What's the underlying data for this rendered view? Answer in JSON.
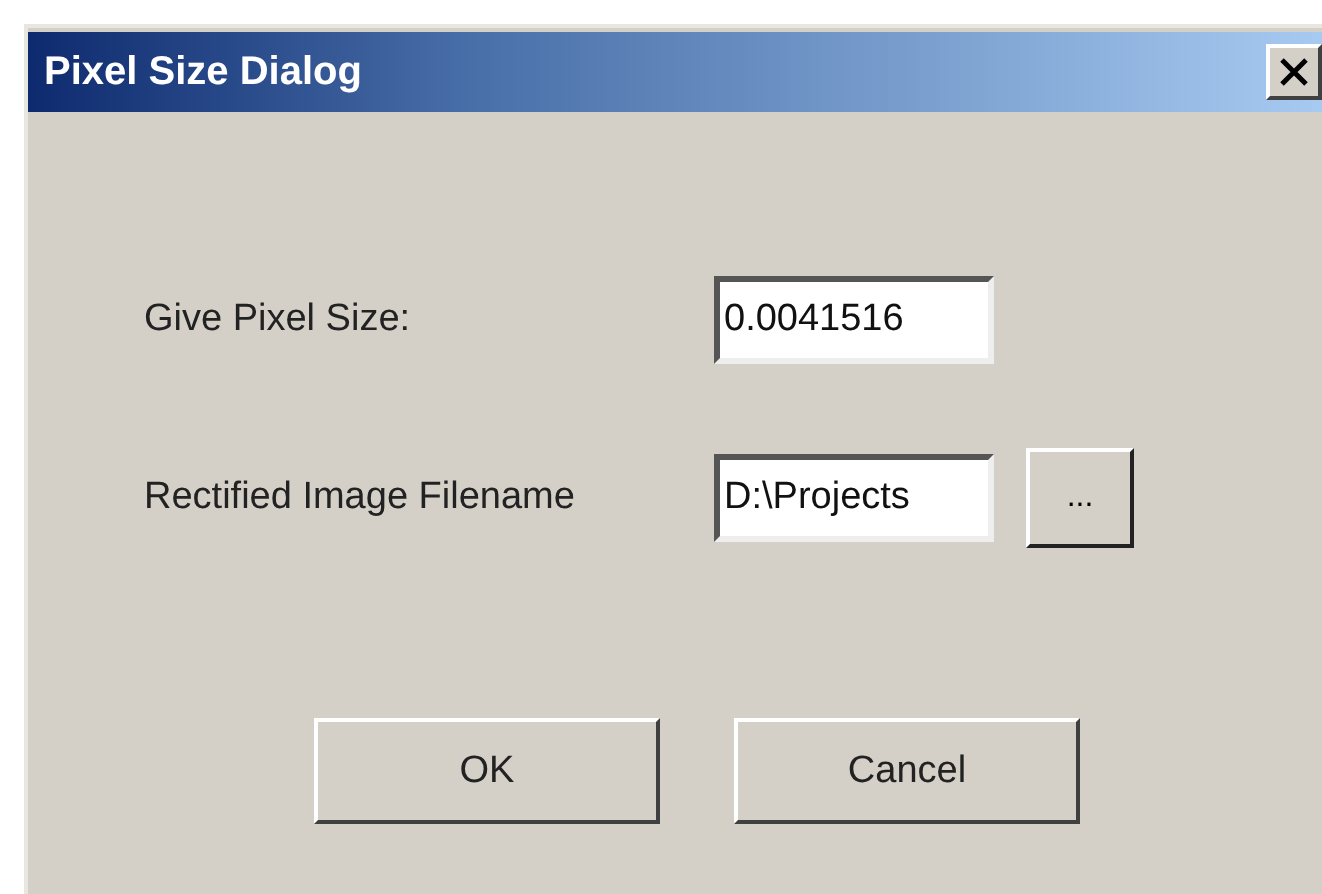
{
  "window": {
    "title": "Pixel Size Dialog"
  },
  "fields": [
    {
      "label": "Give Pixel Size:",
      "value": "0.0041516"
    },
    {
      "label": "Rectified Image Filename",
      "value": "D:\\Projects",
      "browse_label": "..."
    }
  ],
  "buttons": [
    "OK",
    "Cancel"
  ]
}
